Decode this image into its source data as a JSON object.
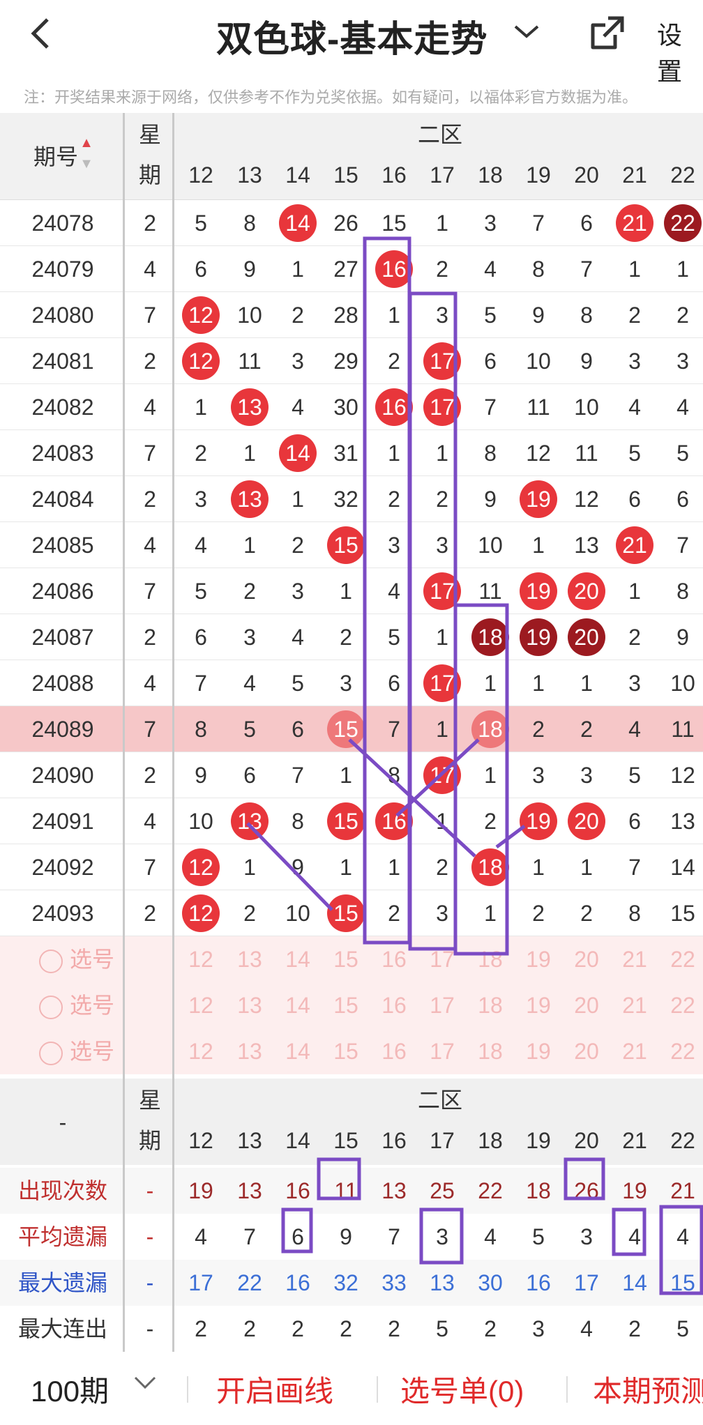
{
  "header": {
    "title": "双色球-基本走势",
    "settings_label": "设置"
  },
  "notice": "注：开奖结果来源于网络，仅供参考不作为兑奖依据。如有疑问，以福体彩官方数据为准。",
  "grid": {
    "col_issue": "期号",
    "col_week_top": "星",
    "col_week_bottom": "期",
    "zone_label": "二区",
    "numbers": [
      "12",
      "13",
      "14",
      "15",
      "16",
      "17",
      "18",
      "19",
      "20",
      "21",
      "22"
    ],
    "rows": [
      {
        "issue": "24078",
        "week": "2",
        "cells": [
          "5",
          "8",
          "14",
          "26",
          "15",
          "1",
          "3",
          "7",
          "6",
          "21",
          "22"
        ]
      },
      {
        "issue": "24079",
        "week": "4",
        "cells": [
          "6",
          "9",
          "1",
          "27",
          "16",
          "2",
          "4",
          "8",
          "7",
          "1",
          "1"
        ]
      },
      {
        "issue": "24080",
        "week": "7",
        "cells": [
          "12",
          "10",
          "2",
          "28",
          "1",
          "3",
          "5",
          "9",
          "8",
          "2",
          "2"
        ]
      },
      {
        "issue": "24081",
        "week": "2",
        "cells": [
          "12",
          "11",
          "3",
          "29",
          "2",
          "17",
          "6",
          "10",
          "9",
          "3",
          "3"
        ]
      },
      {
        "issue": "24082",
        "week": "4",
        "cells": [
          "1",
          "13",
          "4",
          "30",
          "16",
          "17",
          "7",
          "11",
          "10",
          "4",
          "4"
        ]
      },
      {
        "issue": "24083",
        "week": "7",
        "cells": [
          "2",
          "1",
          "14",
          "31",
          "1",
          "1",
          "8",
          "12",
          "11",
          "5",
          "5"
        ]
      },
      {
        "issue": "24084",
        "week": "2",
        "cells": [
          "3",
          "13",
          "1",
          "32",
          "2",
          "2",
          "9",
          "19",
          "12",
          "6",
          "6"
        ]
      },
      {
        "issue": "24085",
        "week": "4",
        "cells": [
          "4",
          "1",
          "2",
          "15",
          "3",
          "3",
          "10",
          "1",
          "13",
          "21",
          "7"
        ]
      },
      {
        "issue": "24086",
        "week": "7",
        "cells": [
          "5",
          "2",
          "3",
          "1",
          "4",
          "17",
          "11",
          "19",
          "20",
          "1",
          "8"
        ]
      },
      {
        "issue": "24087",
        "week": "2",
        "cells": [
          "6",
          "3",
          "4",
          "2",
          "5",
          "1",
          "18",
          "19",
          "20",
          "2",
          "9"
        ]
      },
      {
        "issue": "24088",
        "week": "4",
        "cells": [
          "7",
          "4",
          "5",
          "3",
          "6",
          "17",
          "1",
          "1",
          "1",
          "3",
          "10"
        ]
      },
      {
        "issue": "24089",
        "week": "7",
        "cells": [
          "8",
          "5",
          "6",
          "15",
          "7",
          "1",
          "18",
          "2",
          "2",
          "4",
          "11"
        ]
      },
      {
        "issue": "24090",
        "week": "2",
        "cells": [
          "9",
          "6",
          "7",
          "1",
          "8",
          "17",
          "1",
          "3",
          "3",
          "5",
          "12"
        ]
      },
      {
        "issue": "24091",
        "week": "4",
        "cells": [
          "10",
          "13",
          "8",
          "15",
          "16",
          "1",
          "2",
          "19",
          "20",
          "6",
          "13"
        ]
      },
      {
        "issue": "24092",
        "week": "7",
        "cells": [
          "12",
          "1",
          "9",
          "1",
          "1",
          "2",
          "18",
          "1",
          "1",
          "7",
          "14"
        ]
      },
      {
        "issue": "24093",
        "week": "2",
        "cells": [
          "12",
          "2",
          "10",
          "15",
          "2",
          "3",
          "1",
          "2",
          "2",
          "8",
          "15"
        ]
      }
    ],
    "pick_label": "选号",
    "pick_rows": 3
  },
  "stats": {
    "corner": "-",
    "col_week_top": "星",
    "col_week_bottom": "期",
    "zone_label": "二区",
    "dash": "-",
    "rows": [
      {
        "label": "出现次数",
        "values": [
          "19",
          "13",
          "16",
          "11",
          "13",
          "25",
          "22",
          "18",
          "26",
          "19",
          "21"
        ]
      },
      {
        "label": "平均遗漏",
        "values": [
          "4",
          "7",
          "6",
          "9",
          "7",
          "3",
          "4",
          "5",
          "3",
          "4",
          "4"
        ]
      },
      {
        "label": "最大遗漏",
        "values": [
          "17",
          "22",
          "16",
          "32",
          "33",
          "13",
          "30",
          "16",
          "17",
          "14",
          "15"
        ]
      },
      {
        "label": "最大连出",
        "values": [
          "2",
          "2",
          "2",
          "2",
          "2",
          "5",
          "2",
          "3",
          "4",
          "2",
          "5"
        ]
      }
    ]
  },
  "bottom": {
    "period": "100期",
    "draw_lines": "开启画线",
    "pick_list": "选号单(0)",
    "predict": "本期预测"
  },
  "colors": {
    "ball_red": "#e8363b",
    "ball_dark": "#9c1a20",
    "annotation_purple": "#7b4bc4"
  }
}
